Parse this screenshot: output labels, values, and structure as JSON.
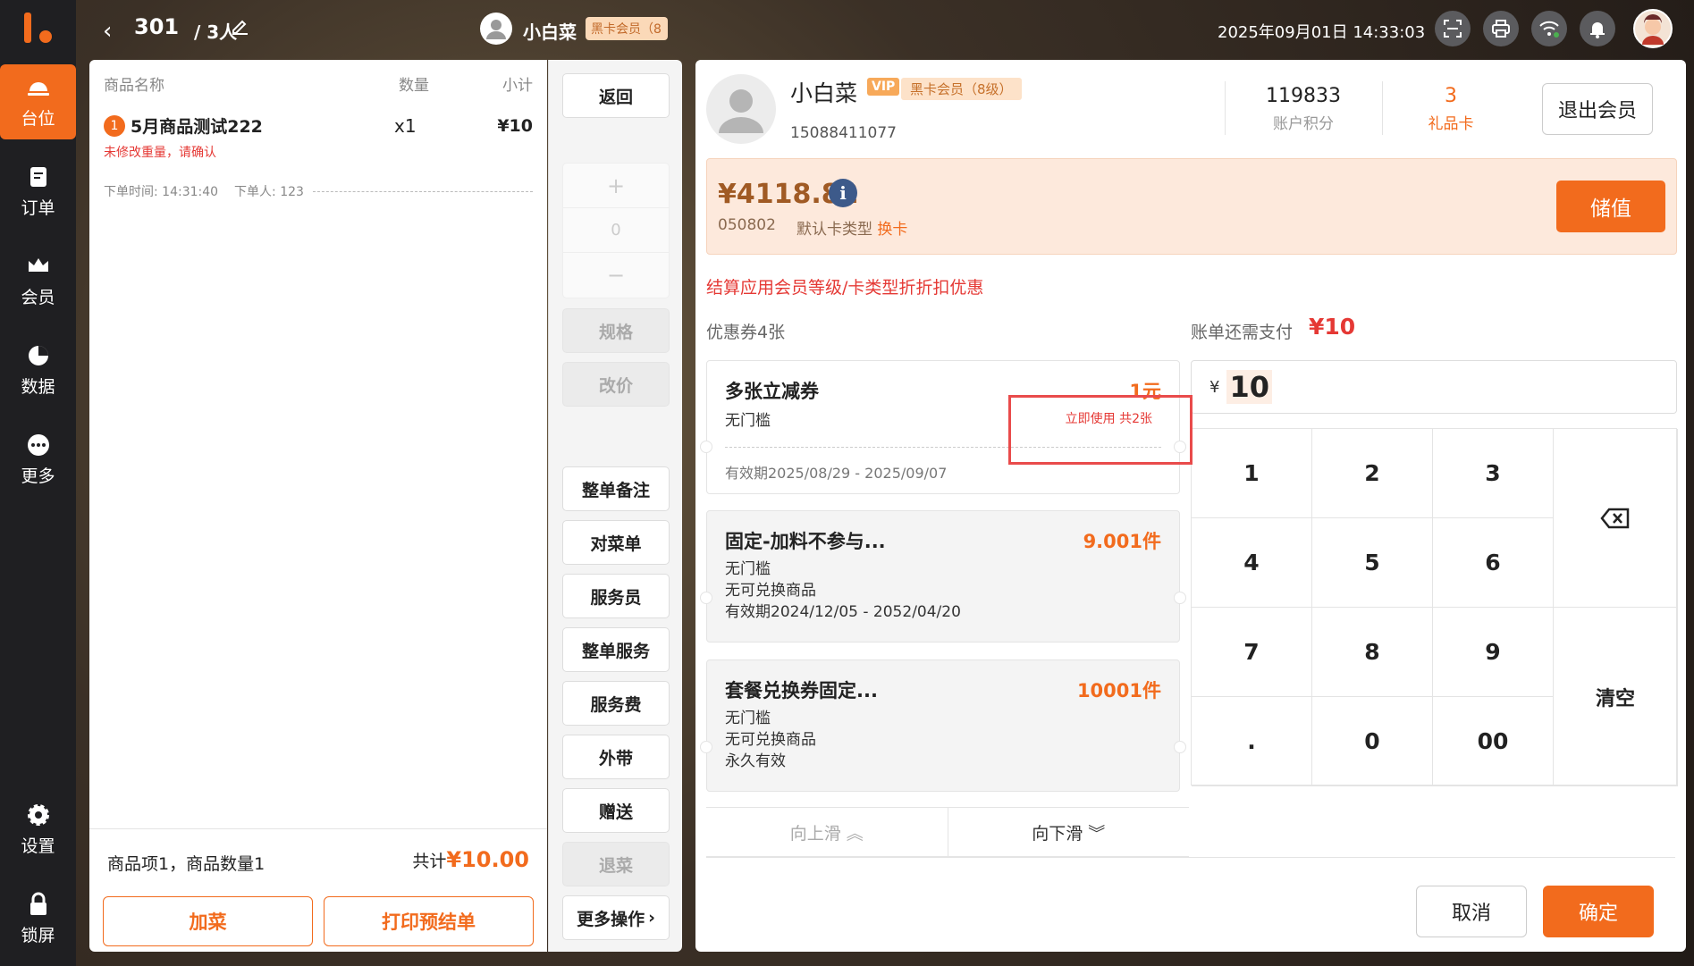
{
  "sidebar": {
    "items": [
      {
        "label": "台位",
        "icon": "table-icon",
        "active": true
      },
      {
        "label": "订单",
        "icon": "order-icon"
      },
      {
        "label": "会员",
        "icon": "crown-icon"
      },
      {
        "label": "数据",
        "icon": "pie-chart-icon"
      },
      {
        "label": "更多",
        "icon": "more-icon"
      }
    ],
    "bottom": [
      {
        "label": "设置",
        "icon": "gear-icon"
      },
      {
        "label": "锁屏",
        "icon": "lock-icon"
      }
    ]
  },
  "topbar": {
    "table_no": "301",
    "guests": "/ 3人",
    "member_name": "小白菜",
    "member_badge": "黑卡会员（8",
    "datetime": "2025年09月01日 14:33:03"
  },
  "order": {
    "col_name": "商品名称",
    "col_qty": "数量",
    "col_subtotal": "小计",
    "items": [
      {
        "index": "1",
        "name": "5月商品测试222",
        "qty": "x1",
        "subtotal": "¥10",
        "warning": "未修改重量，请确认"
      }
    ],
    "order_time": "下单时间: 14:31:40",
    "order_user": "下单人: 123",
    "summary": "商品项1，商品数量1",
    "total_label": "共计",
    "total_value": "¥10.00",
    "add_dish": "加菜",
    "print_pre": "打印预结单"
  },
  "actions": {
    "back": "返回",
    "stepper_plus": "+",
    "stepper_value": "0",
    "stepper_minus": "−",
    "spec": "规格",
    "change_price": "改价",
    "whole_note": "整单备注",
    "check_dish": "对菜单",
    "waiter": "服务员",
    "whole_service": "整单服务",
    "service_fee": "服务费",
    "takeout": "外带",
    "gift": "赠送",
    "return_dish": "退菜",
    "more_ops": "更多操作"
  },
  "member": {
    "name": "小白菜",
    "vip": "VIP",
    "card_level": "黑卡会员（8级）",
    "phone": "15088411077",
    "points_value": "119833",
    "points_label": "账户积分",
    "gift_value": "3",
    "gift_label": "礼品卡",
    "exit": "退出会员",
    "balance": "¥4118.82",
    "card_no": "050802",
    "card_type": "默认卡类型",
    "change_card": "换卡",
    "recharge": "储值",
    "discount_note": "结算应用会员等级/卡类型折折扣优惠",
    "coupon_count": "优惠券4张",
    "due_label": "账单还需支付",
    "due_amount": "¥10",
    "input_currency": "¥",
    "input_value": "10",
    "slide_up": "向上滑",
    "slide_down": "向下滑",
    "cancel": "取消",
    "confirm": "确定",
    "clear": "清空"
  },
  "coupons": [
    {
      "title": "多张立减券",
      "value": "1元",
      "line1": "无门槛",
      "use": "立即使用 共2张",
      "valid": "有效期2025/08/29 - 2025/09/07"
    },
    {
      "title": "固定-加料不参与...",
      "value": "9.001件",
      "line1": "无门槛",
      "line2": "无可兑换商品",
      "valid": "有效期2024/12/05 - 2052/04/20"
    },
    {
      "title": "套餐兑换券固定...",
      "value": "10001件",
      "line1": "无门槛",
      "line2": "无可兑换商品",
      "valid": "永久有效"
    }
  ],
  "keypad": [
    "1",
    "2",
    "3",
    "4",
    "5",
    "6",
    "7",
    "8",
    "9",
    ".",
    "0",
    "00"
  ],
  "colors": {
    "accent": "#f26b1d",
    "danger": "#e53935",
    "sidebar": "#1f1f22"
  }
}
